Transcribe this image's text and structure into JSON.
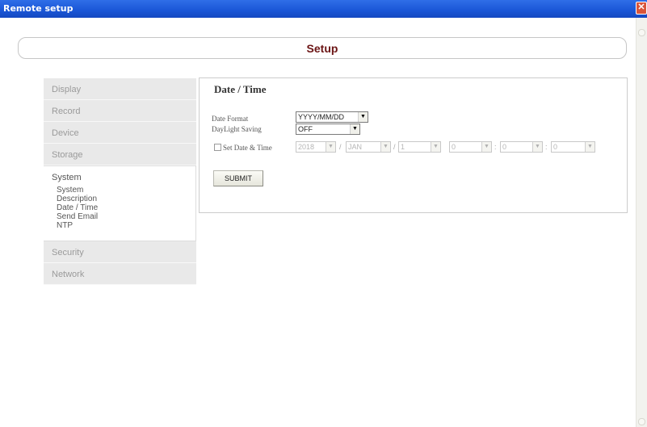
{
  "window": {
    "title": "Remote setup"
  },
  "header": {
    "heading": "Setup"
  },
  "sidebar": {
    "items_top": [
      "Display",
      "Record",
      "Device",
      "Storage"
    ],
    "active_group": {
      "title": "System",
      "sub_items": [
        "System",
        "Description",
        "Date / Time",
        "Send Email",
        "NTP"
      ]
    },
    "items_bottom": [
      "Security",
      "Network"
    ]
  },
  "content": {
    "section_title": "Date / Time",
    "date_format": {
      "label": "Date Format",
      "value": "YYYY/MM/DD"
    },
    "daylight": {
      "label": "DayLight Saving",
      "value": "OFF"
    },
    "set_datetime": {
      "label": "Set Date & Time",
      "checked": false,
      "year": "2018",
      "month": "JAN",
      "day": "1",
      "hour": "0",
      "minute": "0",
      "second": "0",
      "sep_date": "/",
      "sep_time": ":"
    },
    "submit_label": "SUBMIT"
  }
}
